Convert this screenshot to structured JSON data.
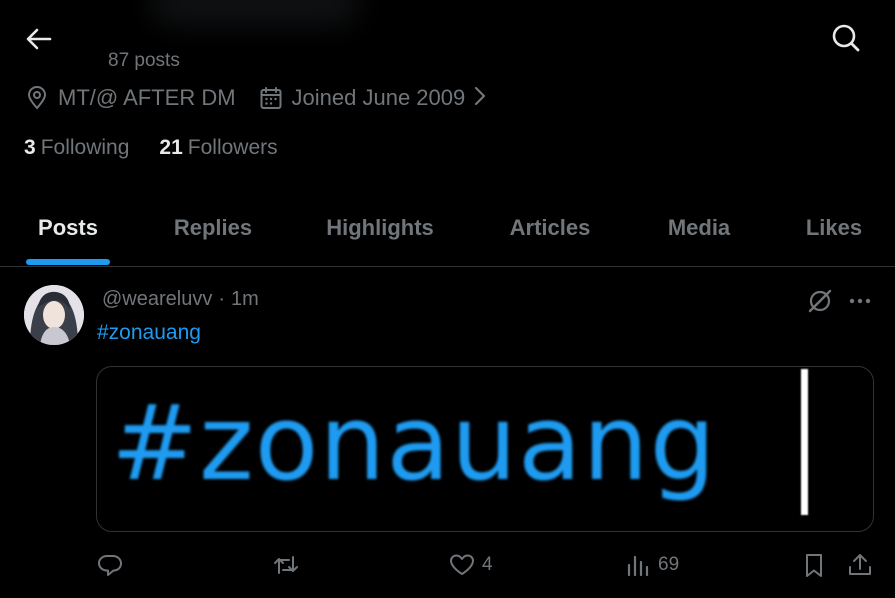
{
  "profile": {
    "post_count": "87 posts",
    "location": "MT/@ AFTER DM",
    "joined": "Joined June 2009",
    "following_count": "3",
    "following_label": "Following",
    "followers_count": "21",
    "followers_label": "Followers"
  },
  "tabs": [
    {
      "label": "Posts",
      "active": true
    },
    {
      "label": "Replies",
      "active": false
    },
    {
      "label": "Highlights",
      "active": false
    },
    {
      "label": "Articles",
      "active": false
    },
    {
      "label": "Media",
      "active": false
    },
    {
      "label": "Likes",
      "active": false
    }
  ],
  "post": {
    "handle": "@weareluvv",
    "separator": "·",
    "time": "1m",
    "hashtag": "#zonauang",
    "media_text": "#zonauang",
    "actions": {
      "reply_count": "",
      "repost_count": "",
      "like_count": "4",
      "views_count": "69"
    }
  },
  "icons": {
    "back": "arrow-left-icon",
    "search": "search-icon",
    "location": "location-pin-icon",
    "calendar": "calendar-icon",
    "chevron": "chevron-right-icon",
    "grok": "grok-icon",
    "more": "more-icon",
    "reply": "reply-icon",
    "repost": "repost-icon",
    "like": "heart-icon",
    "views": "views-icon",
    "bookmark": "bookmark-icon",
    "share": "share-icon"
  },
  "colors": {
    "background": "#000000",
    "text": "#e7e9ea",
    "muted": "#71767b",
    "accent": "#1d9bf0",
    "divider": "#2f3336"
  }
}
